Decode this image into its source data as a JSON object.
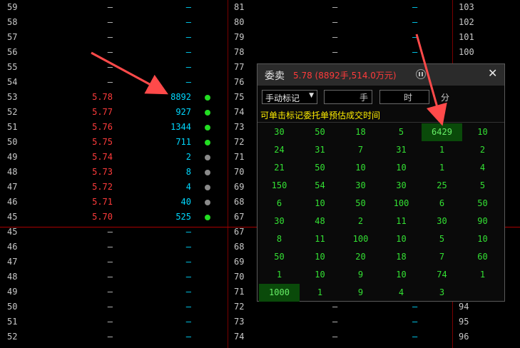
{
  "board": {
    "left_rows": [
      {
        "level": "59",
        "price": "–",
        "vol": "–",
        "dot": ""
      },
      {
        "level": "58",
        "price": "–",
        "vol": "–",
        "dot": ""
      },
      {
        "level": "57",
        "price": "–",
        "vol": "–",
        "dot": ""
      },
      {
        "level": "56",
        "price": "–",
        "vol": "–",
        "dot": ""
      },
      {
        "level": "55",
        "price": "–",
        "vol": "–",
        "dot": ""
      },
      {
        "level": "54",
        "price": "–",
        "vol": "–",
        "dot": ""
      },
      {
        "level": "53",
        "price": "5.78",
        "vol": "8892",
        "dot": "green"
      },
      {
        "level": "52",
        "price": "5.77",
        "vol": "927",
        "dot": "green"
      },
      {
        "level": "51",
        "price": "5.76",
        "vol": "1344",
        "dot": "green"
      },
      {
        "level": "50",
        "price": "5.75",
        "vol": "711",
        "dot": "green"
      },
      {
        "level": "49",
        "price": "5.74",
        "vol": "2",
        "dot": "gray"
      },
      {
        "level": "48",
        "price": "5.73",
        "vol": "8",
        "dot": "gray"
      },
      {
        "level": "47",
        "price": "5.72",
        "vol": "4",
        "dot": "gray"
      },
      {
        "level": "46",
        "price": "5.71",
        "vol": "40",
        "dot": "gray"
      },
      {
        "level": "45",
        "price": "5.70",
        "vol": "525",
        "dot": "green"
      },
      {
        "level": "45",
        "price": "–",
        "vol": "–",
        "dot": ""
      },
      {
        "level": "46",
        "price": "–",
        "vol": "–",
        "dot": ""
      },
      {
        "level": "47",
        "price": "–",
        "vol": "–",
        "dot": ""
      },
      {
        "level": "48",
        "price": "–",
        "vol": "–",
        "dot": ""
      },
      {
        "level": "49",
        "price": "–",
        "vol": "–",
        "dot": ""
      },
      {
        "level": "50",
        "price": "–",
        "vol": "–",
        "dot": ""
      },
      {
        "level": "51",
        "price": "–",
        "vol": "–",
        "dot": ""
      },
      {
        "level": "52",
        "price": "–",
        "vol": "–",
        "dot": ""
      }
    ],
    "mid_rows": [
      {
        "level": "81",
        "v": "–",
        "s": "–"
      },
      {
        "level": "80",
        "v": "–",
        "s": "–"
      },
      {
        "level": "79",
        "v": "–",
        "s": "–"
      },
      {
        "level": "78",
        "v": "–",
        "s": "–"
      },
      {
        "level": "77",
        "v": "",
        "s": ""
      },
      {
        "level": "76",
        "v": "",
        "s": ""
      },
      {
        "level": "75",
        "v": "",
        "s": ""
      },
      {
        "level": "74",
        "v": "",
        "s": ""
      },
      {
        "level": "73",
        "v": "",
        "s": ""
      },
      {
        "level": "72",
        "v": "",
        "s": ""
      },
      {
        "level": "71",
        "v": "",
        "s": ""
      },
      {
        "level": "70",
        "v": "",
        "s": ""
      },
      {
        "level": "69",
        "v": "",
        "s": ""
      },
      {
        "level": "68",
        "v": "",
        "s": ""
      },
      {
        "level": "67",
        "v": "",
        "s": ""
      },
      {
        "level": "67",
        "v": "",
        "s": ""
      },
      {
        "level": "68",
        "v": "",
        "s": ""
      },
      {
        "level": "69",
        "v": "",
        "s": ""
      },
      {
        "level": "70",
        "v": "",
        "s": ""
      },
      {
        "level": "71",
        "v": "",
        "s": ""
      },
      {
        "level": "72",
        "v": "–",
        "s": "–"
      },
      {
        "level": "73",
        "v": "–",
        "s": "–"
      },
      {
        "level": "74",
        "v": "–",
        "s": "–"
      }
    ],
    "right_rows": [
      "103",
      "102",
      "101",
      "100",
      "",
      "",
      "",
      "",
      "",
      "",
      "",
      "",
      "",
      "",
      "",
      "",
      "",
      "",
      "",
      "",
      "94",
      "95",
      "96"
    ]
  },
  "popup": {
    "title": "委卖",
    "summary": "5.78 (8892手,514.0万元)",
    "close": "✕",
    "mode": "手动标记",
    "unit_hand": "手",
    "unit_time": "时",
    "unit_minute": "分",
    "hint": "可单击标记委托单预估成交时间",
    "orders": [
      [
        "30",
        "50",
        "18",
        "5",
        "6429",
        "10"
      ],
      [
        "24",
        "31",
        "7",
        "31",
        "1",
        "2"
      ],
      [
        "21",
        "50",
        "10",
        "10",
        "1",
        "4"
      ],
      [
        "150",
        "54",
        "30",
        "30",
        "25",
        "5"
      ],
      [
        "6",
        "10",
        "50",
        "100",
        "6",
        "50"
      ],
      [
        "30",
        "48",
        "2",
        "11",
        "30",
        "90"
      ],
      [
        "8",
        "11",
        "100",
        "10",
        "5",
        "10"
      ],
      [
        "50",
        "10",
        "20",
        "18",
        "7",
        "60"
      ],
      [
        "1",
        "10",
        "9",
        "10",
        "74",
        "1"
      ],
      [
        "1000",
        "1",
        "9",
        "4",
        "3",
        ""
      ]
    ],
    "highlighted": [
      [
        0,
        4
      ],
      [
        9,
        0
      ]
    ]
  },
  "colors": {
    "up": "#ff3b3b",
    "vol": "#00d8ff",
    "order": "#33e033",
    "hint": "#ffee00",
    "accent_arrow": "#ff4a4a"
  }
}
